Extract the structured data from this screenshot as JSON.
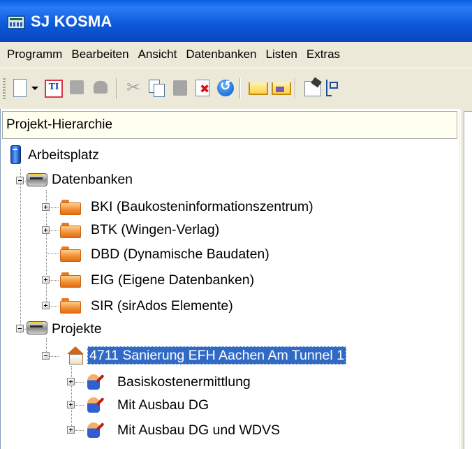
{
  "window": {
    "title": "SJ KOSMA"
  },
  "menu": [
    "Programm",
    "Bearbeiten",
    "Ansicht",
    "Datenbanken",
    "Listen",
    "Extras"
  ],
  "toolbar": {
    "icons": [
      "new-document-icon",
      "dropdown-arrow-icon",
      "text-icon",
      "gray-block-icon",
      "gray-stamp-icon",
      "cut-icon",
      "copy-icon",
      "paste-icon",
      "delete-icon",
      "undo-icon",
      "database-in-icon",
      "database-out-icon",
      "properties-icon",
      "tree-view-icon"
    ]
  },
  "panel": {
    "title": "Projekt-Hierarchie"
  },
  "tree": {
    "root": "Arbeitsplatz",
    "databases": {
      "label": "Datenbanken",
      "items": [
        "BKI (Baukosteninformationszentrum)",
        "BTK (Wingen-Verlag)",
        "DBD (Dynamische Baudaten)",
        "EIG (Eigene Datenbanken)",
        "SIR (sirAdos Elemente)"
      ]
    },
    "projects": {
      "label": "Projekte",
      "project": "4711 Sanierung EFH Aachen Am Tunnel 1",
      "children": [
        "Basiskostenermittlung",
        "Mit Ausbau DG",
        "Mit Ausbau DG und WDVS"
      ]
    }
  }
}
